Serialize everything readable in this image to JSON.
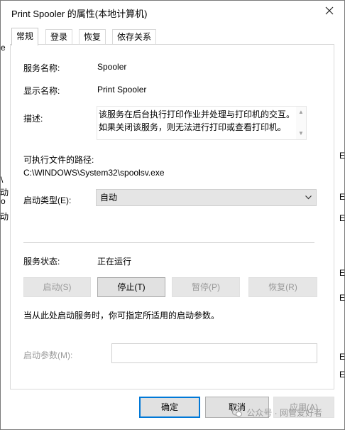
{
  "window": {
    "title": "Print Spooler 的属性(本地计算机)",
    "close_icon": "close-icon"
  },
  "tabs": [
    {
      "label": "常规",
      "active": true
    },
    {
      "label": "登录",
      "active": false
    },
    {
      "label": "恢复",
      "active": false
    },
    {
      "label": "依存关系",
      "active": false
    }
  ],
  "general": {
    "service_name_label": "服务名称:",
    "service_name_value": "Spooler",
    "display_name_label": "显示名称:",
    "display_name_value": "Print Spooler",
    "description_label": "描述:",
    "description_value": "该服务在后台执行打印作业并处理与打印机的交互。如果关闭该服务，则无法进行打印或查看打印机。",
    "exe_path_label": "可执行文件的路径:",
    "exe_path_value": "C:\\WINDOWS\\System32\\spoolsv.exe",
    "startup_type_label": "启动类型(E):",
    "startup_type_value": "自动",
    "status_label": "服务状态:",
    "status_value": "正在运行",
    "buttons": {
      "start": "启动(S)",
      "stop": "停止(T)",
      "pause": "暂停(P)",
      "resume": "恢复(R)"
    },
    "hint": "当从此处启动服务时，你可指定所适用的启动参数。",
    "param_label": "启动参数(M):",
    "param_value": ""
  },
  "footer": {
    "ok": "确定",
    "cancel": "取消",
    "apply": "应用(A)"
  },
  "edge_fragments": {
    "left": [
      "e",
      "\\",
      "动",
      "o",
      "动"
    ],
    "right": [
      "E",
      "E",
      "E",
      "E",
      "E",
      "E",
      "E"
    ]
  },
  "watermark": "公众号 · 网管爱好者",
  "colors": {
    "accent": "#0078d7",
    "border": "#d9d9d9",
    "disabled_text": "#9a9a9a"
  }
}
